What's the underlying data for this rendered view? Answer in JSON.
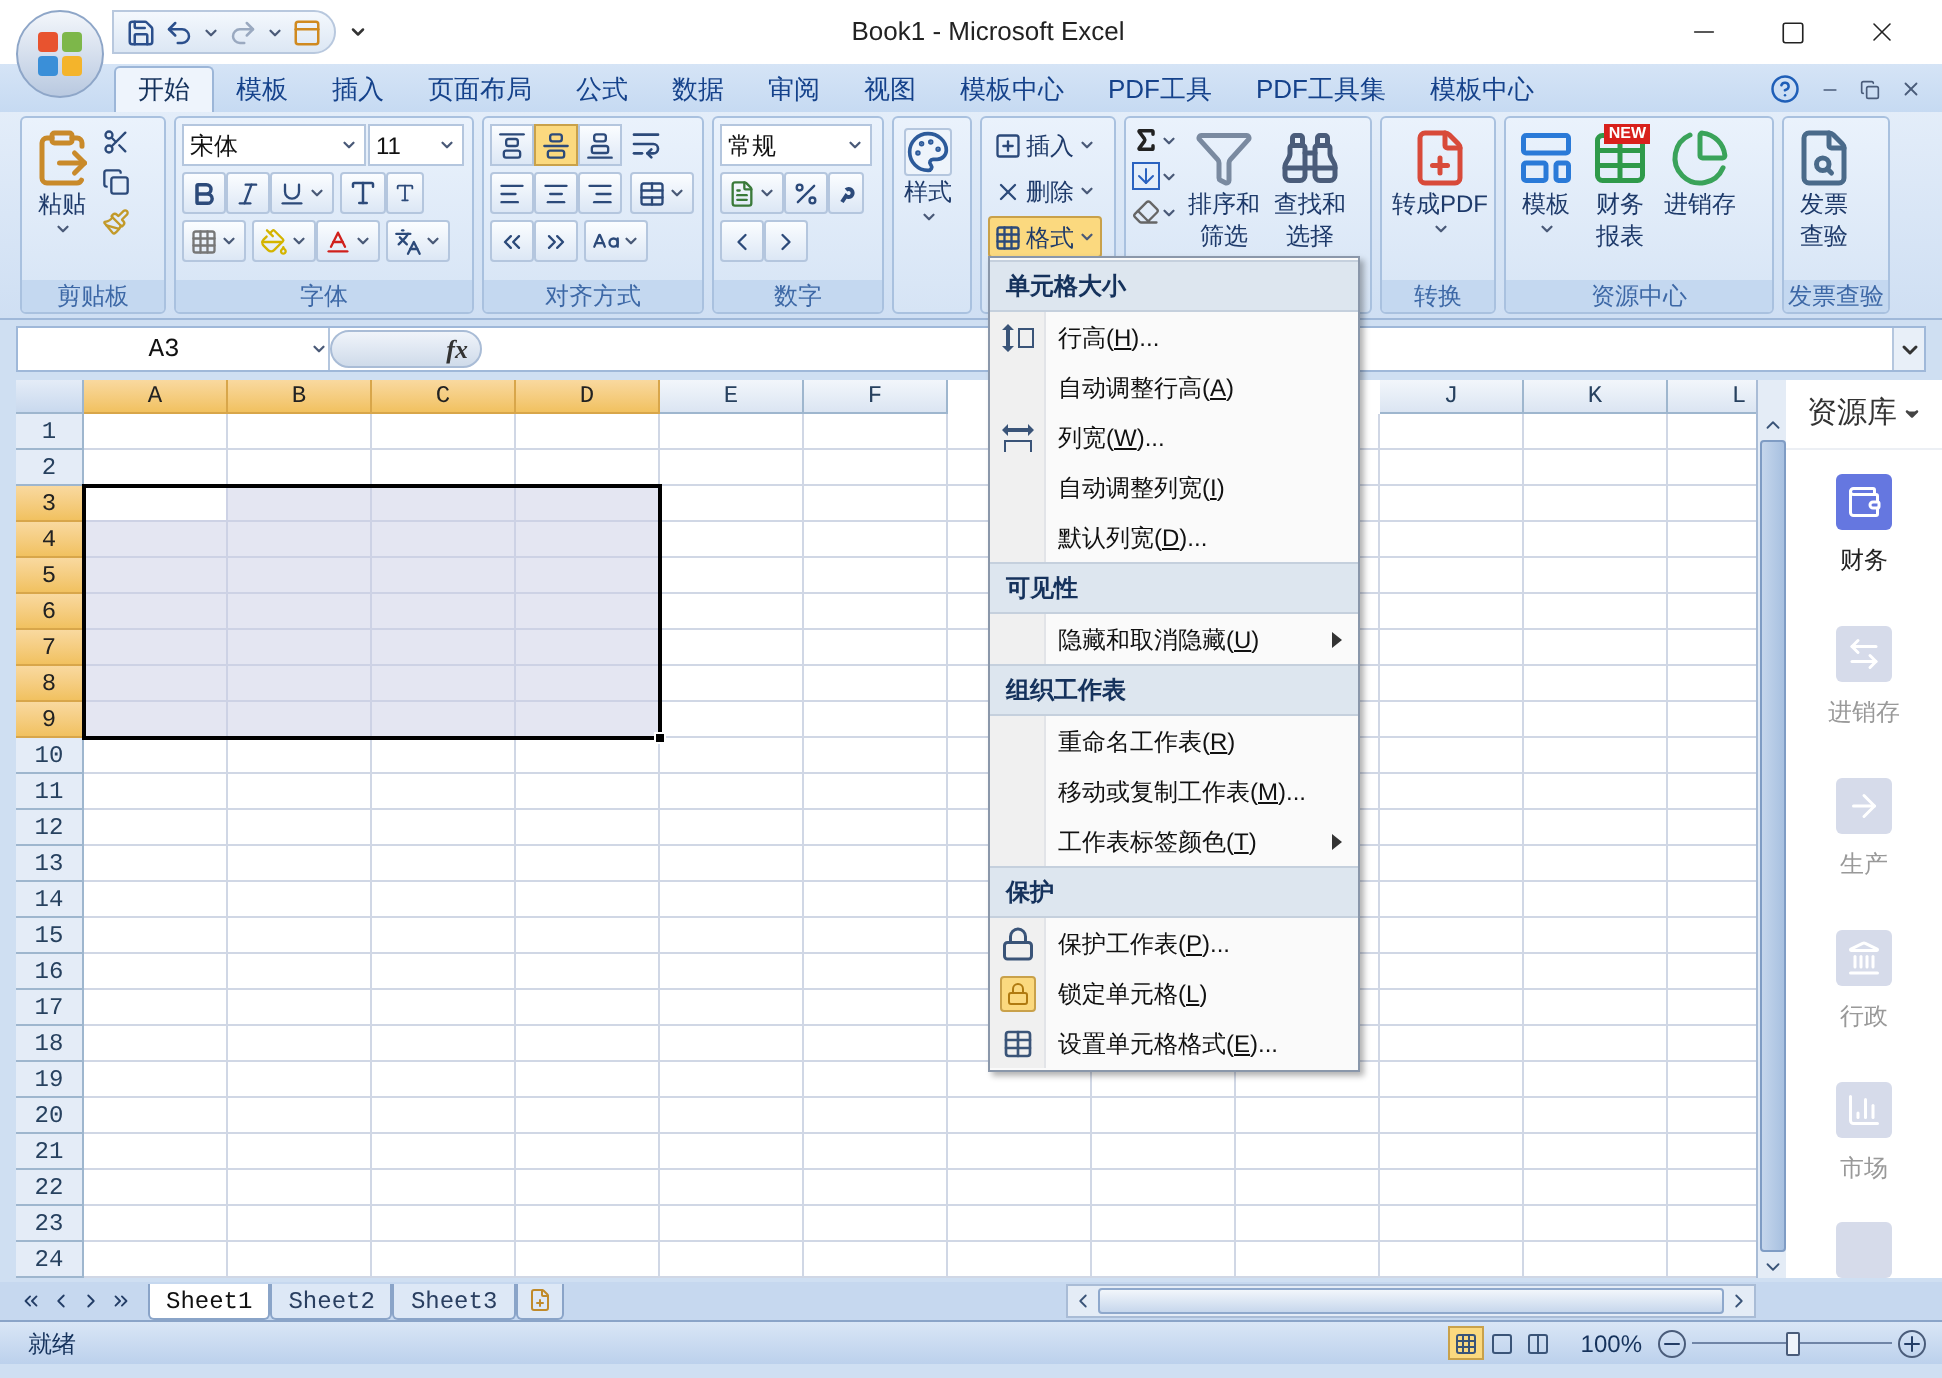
{
  "title_bar": {
    "title": "Book1 - Microsoft Excel"
  },
  "tabs": [
    {
      "label": "开始",
      "selected": true
    },
    {
      "label": "模板",
      "selected": false
    },
    {
      "label": "插入",
      "selected": false
    },
    {
      "label": "页面布局",
      "selected": false
    },
    {
      "label": "公式",
      "selected": false
    },
    {
      "label": "数据",
      "selected": false
    },
    {
      "label": "审阅",
      "selected": false
    },
    {
      "label": "视图",
      "selected": false
    },
    {
      "label": "模板中心",
      "selected": false
    },
    {
      "label": "PDF工具",
      "selected": false
    },
    {
      "label": "PDF工具集",
      "selected": false
    },
    {
      "label": "模板中心",
      "selected": false
    }
  ],
  "ribbon": {
    "clipboard": {
      "label": "剪贴板",
      "paste": "粘贴"
    },
    "font": {
      "label": "字体",
      "font_name": "宋体",
      "font_size": "11"
    },
    "alignment": {
      "label": "对齐方式",
      "vertical": [
        {
          "kind": "top",
          "selected": false
        },
        {
          "kind": "middle",
          "selected": true
        },
        {
          "kind": "bottom",
          "selected": false
        }
      ]
    },
    "number": {
      "label": "数字",
      "format": "常规"
    },
    "styles": {
      "label": "样式"
    },
    "cells": [
      {
        "kind": "insert",
        "label": "插入",
        "expanded": false
      },
      {
        "kind": "delete",
        "label": "删除",
        "expanded": false
      },
      {
        "kind": "format",
        "label": "格式",
        "expanded": true
      }
    ],
    "editing": {
      "sort_lines": [
        "排序和",
        "筛选"
      ],
      "find_lines": [
        "查找和",
        "选择"
      ]
    },
    "convert": {
      "label": "转换",
      "button": "转成PDF"
    },
    "resource_center": {
      "label": "资源中心",
      "buttons": [
        {
          "kind": "template",
          "lines": [
            "模板"
          ]
        },
        {
          "kind": "finance",
          "lines": [
            "财务",
            "报表"
          ],
          "badge": "NEW"
        },
        {
          "kind": "inventory",
          "lines": [
            "进销存"
          ]
        }
      ]
    },
    "invoice": {
      "label": "发票查验",
      "lines": [
        "发票",
        "查验"
      ]
    }
  },
  "formula_bar": {
    "name_box": "A3",
    "function_label": "fx"
  },
  "grid": {
    "columns_left": [
      {
        "label": "A",
        "selected": true
      },
      {
        "label": "B",
        "selected": true
      },
      {
        "label": "C",
        "selected": true
      },
      {
        "label": "D",
        "selected": true
      },
      {
        "label": "E",
        "selected": false
      },
      {
        "label": "F",
        "selected": false
      }
    ],
    "columns_right": [
      {
        "label": "J",
        "selected": false
      },
      {
        "label": "K",
        "selected": false
      },
      {
        "label": "L",
        "selected": false
      }
    ],
    "rows": [
      {
        "label": "1",
        "selected": false
      },
      {
        "label": "2",
        "selected": false
      },
      {
        "label": "3",
        "selected": true
      },
      {
        "label": "4",
        "selected": true
      },
      {
        "label": "5",
        "selected": true
      },
      {
        "label": "6",
        "selected": true
      },
      {
        "label": "7",
        "selected": true
      },
      {
        "label": "8",
        "selected": true
      },
      {
        "label": "9",
        "selected": true
      },
      {
        "label": "10",
        "selected": false
      },
      {
        "label": "11",
        "selected": false
      },
      {
        "label": "12",
        "selected": false
      },
      {
        "label": "13",
        "selected": false
      },
      {
        "label": "14",
        "selected": false
      },
      {
        "label": "15",
        "selected": false
      },
      {
        "label": "16",
        "selected": false
      },
      {
        "label": "17",
        "selected": false
      },
      {
        "label": "18",
        "selected": false
      },
      {
        "label": "19",
        "selected": false
      },
      {
        "label": "20",
        "selected": false
      },
      {
        "label": "21",
        "selected": false
      },
      {
        "label": "22",
        "selected": false
      },
      {
        "label": "23",
        "selected": false
      },
      {
        "label": "24",
        "selected": false
      }
    ]
  },
  "menu": {
    "sections": [
      {
        "heading": "单元格大小",
        "items": [
          {
            "label": "行高(H)...",
            "kind": "row-height",
            "submenu": false,
            "checked": false
          },
          {
            "label": "自动调整行高(A)",
            "kind": "plain",
            "submenu": false,
            "checked": false
          },
          {
            "label": "列宽(W)...",
            "kind": "column-width",
            "submenu": false,
            "checked": false
          },
          {
            "label": "自动调整列宽(I)",
            "kind": "plain",
            "submenu": false,
            "checked": false
          },
          {
            "label": "默认列宽(D)...",
            "kind": "plain",
            "submenu": false,
            "checked": false
          }
        ]
      },
      {
        "heading": "可见性",
        "items": [
          {
            "label": "隐藏和取消隐藏(U)",
            "kind": "plain",
            "submenu": true,
            "checked": false
          }
        ]
      },
      {
        "heading": "组织工作表",
        "items": [
          {
            "label": "重命名工作表(R)",
            "kind": "plain",
            "submenu": false,
            "checked": false
          },
          {
            "label": "移动或复制工作表(M)...",
            "kind": "plain",
            "submenu": false,
            "checked": false
          },
          {
            "label": "工作表标签颜色(T)",
            "kind": "plain",
            "submenu": true,
            "checked": false
          }
        ]
      },
      {
        "heading": "保护",
        "items": [
          {
            "label": "保护工作表(P)...",
            "kind": "protect",
            "submenu": false,
            "checked": false
          },
          {
            "label": "锁定单元格(L)",
            "kind": "lock",
            "submenu": false,
            "checked": true
          },
          {
            "label": "设置单元格格式(E)...",
            "kind": "format-cells",
            "submenu": false,
            "checked": false
          }
        ]
      }
    ]
  },
  "side_panel": {
    "title": "资源库",
    "items": [
      {
        "label": "财务",
        "kind": "wallet",
        "selected": true
      },
      {
        "label": "进销存",
        "kind": "exchange",
        "selected": false
      },
      {
        "label": "生产",
        "kind": "arrow",
        "selected": false
      },
      {
        "label": "行政",
        "kind": "bank",
        "selected": false
      },
      {
        "label": "市场",
        "kind": "chart",
        "selected": false
      }
    ]
  },
  "sheets": [
    {
      "label": "Sheet1",
      "selected": true
    },
    {
      "label": "Sheet2",
      "selected": false
    },
    {
      "label": "Sheet3",
      "selected": false
    }
  ],
  "status_bar": {
    "status": "就绪",
    "views": [
      {
        "kind": "normal",
        "selected": true
      },
      {
        "kind": "page-layout",
        "selected": false
      },
      {
        "kind": "page-break",
        "selected": false
      }
    ],
    "zoom": "100%",
    "zoom_slider": {
      "level": 0.5
    }
  }
}
